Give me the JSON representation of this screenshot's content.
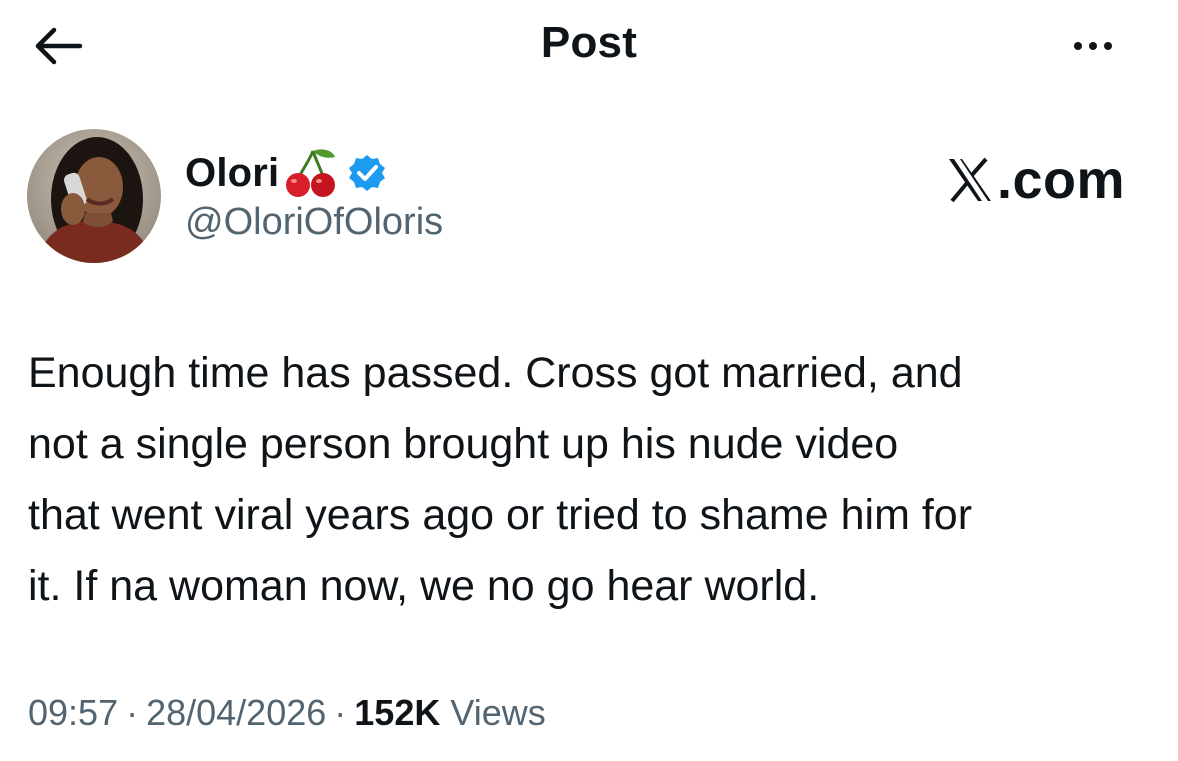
{
  "header": {
    "title": "Post",
    "back_icon": "arrow-left-icon",
    "more_icon": "more-horizontal-icon"
  },
  "author": {
    "display_name": "Olori",
    "name_emoji": "cherries-icon",
    "verified_icon": "verified-badge-icon",
    "verified_color": "#1d9bf0",
    "handle": "@OloriOfOloris"
  },
  "watermark": {
    "text": ".com",
    "logo": "x-logo-icon"
  },
  "post": {
    "text": "Enough time has passed. Cross got married, and\nnot a single person brought up his nude video\nthat went viral years ago or tried to shame him for\nit. If na woman now, we no go hear world."
  },
  "meta": {
    "time": "09:57",
    "separator": "·",
    "date": "28/04/2026",
    "views_count": "152K",
    "views_label": "Views"
  },
  "colors": {
    "text_primary": "#0f1419",
    "text_secondary": "#536471",
    "background": "#ffffff"
  }
}
